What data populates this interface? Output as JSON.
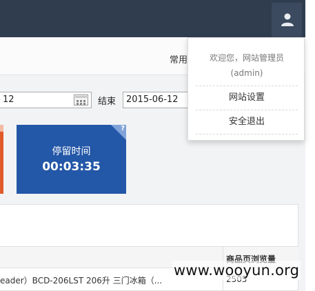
{
  "header": {
    "user_icon": "user-icon"
  },
  "subheader": {
    "common_text": "常用"
  },
  "date_filter": {
    "start_value": "12",
    "end_label": "结束",
    "end_value": "2015-06-12",
    "calendar_icon": "calendar-icon"
  },
  "stats": {
    "stay_time_label": "停留时间",
    "stay_time_value": "00:03:35",
    "help_mark": "?",
    "card_colors": {
      "red": "#e05a2b",
      "blue": "#2357a7"
    }
  },
  "table": {
    "columns": [
      "商品页浏览量"
    ],
    "rows": [
      {
        "name": "eader）BCD-206LST 206升 三门冰箱（...",
        "views": "2505"
      }
    ]
  },
  "user_menu": {
    "welcome": "欢迎您，网站管理员",
    "username": "(admin)",
    "items": [
      "网站设置",
      "安全退出"
    ]
  },
  "watermark": {
    "text": "www.wooyun.org"
  },
  "colors": {
    "navbar": "#2f3d4f",
    "content_bg": "#f2f3f5"
  }
}
